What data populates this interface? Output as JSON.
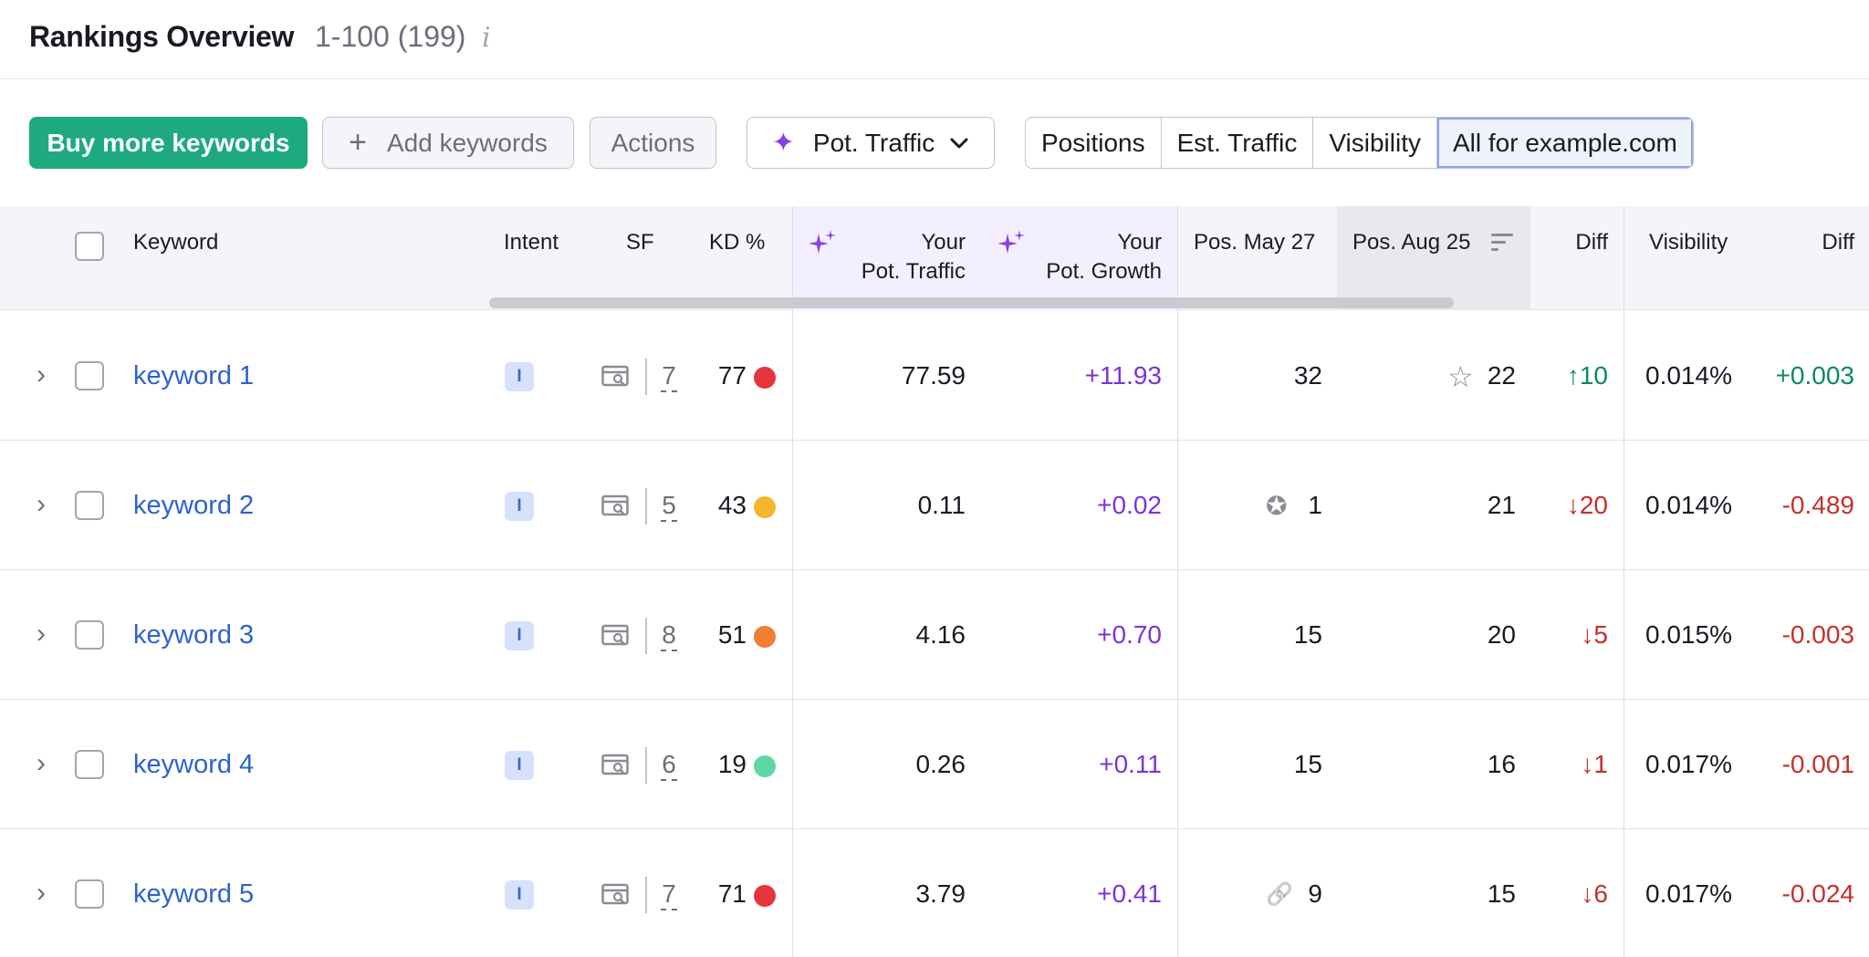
{
  "header": {
    "title": "Rankings Overview",
    "range": "1-100 (199)",
    "info_icon": "i"
  },
  "toolbar": {
    "buy_label": "Buy more keywords",
    "add_label": "Add keywords",
    "actions_label": "Actions",
    "pot_label": "Pot. Traffic",
    "segments": [
      "Positions",
      "Est. Traffic",
      "Visibility",
      "All for example.com"
    ],
    "active_segment": "All for example.com"
  },
  "columns": {
    "keyword": "Keyword",
    "intent": "Intent",
    "sf": "SF",
    "kd": "KD %",
    "pot_traffic_1": "Your",
    "pot_traffic_2": "Pot. Traffic",
    "pot_growth_1": "Your",
    "pot_growth_2": "Pot. Growth",
    "pos_may": "Pos. May 27",
    "pos_aug": "Pos. Aug 25",
    "diff": "Diff",
    "visibility": "Visibility",
    "vis_diff": "Diff"
  },
  "rows": [
    {
      "keyword": "keyword 1",
      "intent": "I",
      "sf": "7",
      "kd": "77",
      "kd_color": "#e5343b",
      "pot_traffic": "77.59",
      "pot_growth": "+11.93",
      "pos_may": "32",
      "pos_may_icon": "",
      "pos_aug": "22",
      "pos_aug_icon": "star-icon",
      "diff": "10",
      "diff_dir": "up",
      "visibility": "0.014%",
      "vis_diff": "+0.003",
      "vis_dir": "up"
    },
    {
      "keyword": "keyword 2",
      "intent": "I",
      "sf": "5",
      "kd": "43",
      "kd_color": "#f6b62a",
      "pot_traffic": "0.11",
      "pot_growth": "+0.02",
      "pos_may": "1",
      "pos_may_icon": "ai-overview-icon",
      "pos_aug": "21",
      "pos_aug_icon": "",
      "diff": "20",
      "diff_dir": "down",
      "visibility": "0.014%",
      "vis_diff": "-0.489",
      "vis_dir": "down"
    },
    {
      "keyword": "keyword 3",
      "intent": "I",
      "sf": "8",
      "kd": "51",
      "kd_color": "#f07f2f",
      "pot_traffic": "4.16",
      "pot_growth": "+0.70",
      "pos_may": "15",
      "pos_may_icon": "",
      "pos_aug": "20",
      "pos_aug_icon": "",
      "diff": "5",
      "diff_dir": "down",
      "visibility": "0.015%",
      "vis_diff": "-0.003",
      "vis_dir": "down"
    },
    {
      "keyword": "keyword 4",
      "intent": "I",
      "sf": "6",
      "kd": "19",
      "kd_color": "#5fd6a4",
      "pot_traffic": "0.26",
      "pot_growth": "+0.11",
      "pos_may": "15",
      "pos_may_icon": "",
      "pos_aug": "16",
      "pos_aug_icon": "",
      "diff": "1",
      "diff_dir": "down",
      "visibility": "0.017%",
      "vis_diff": "-0.001",
      "vis_dir": "down"
    },
    {
      "keyword": "keyword 5",
      "intent": "I",
      "sf": "7",
      "kd": "71",
      "kd_color": "#e5343b",
      "pot_traffic": "3.79",
      "pot_growth": "+0.41",
      "pos_may": "9",
      "pos_may_icon": "link-icon",
      "pos_aug": "15",
      "pos_aug_icon": "",
      "diff": "6",
      "diff_dir": "down",
      "visibility": "0.017%",
      "vis_diff": "-0.024",
      "vis_dir": "down"
    }
  ]
}
